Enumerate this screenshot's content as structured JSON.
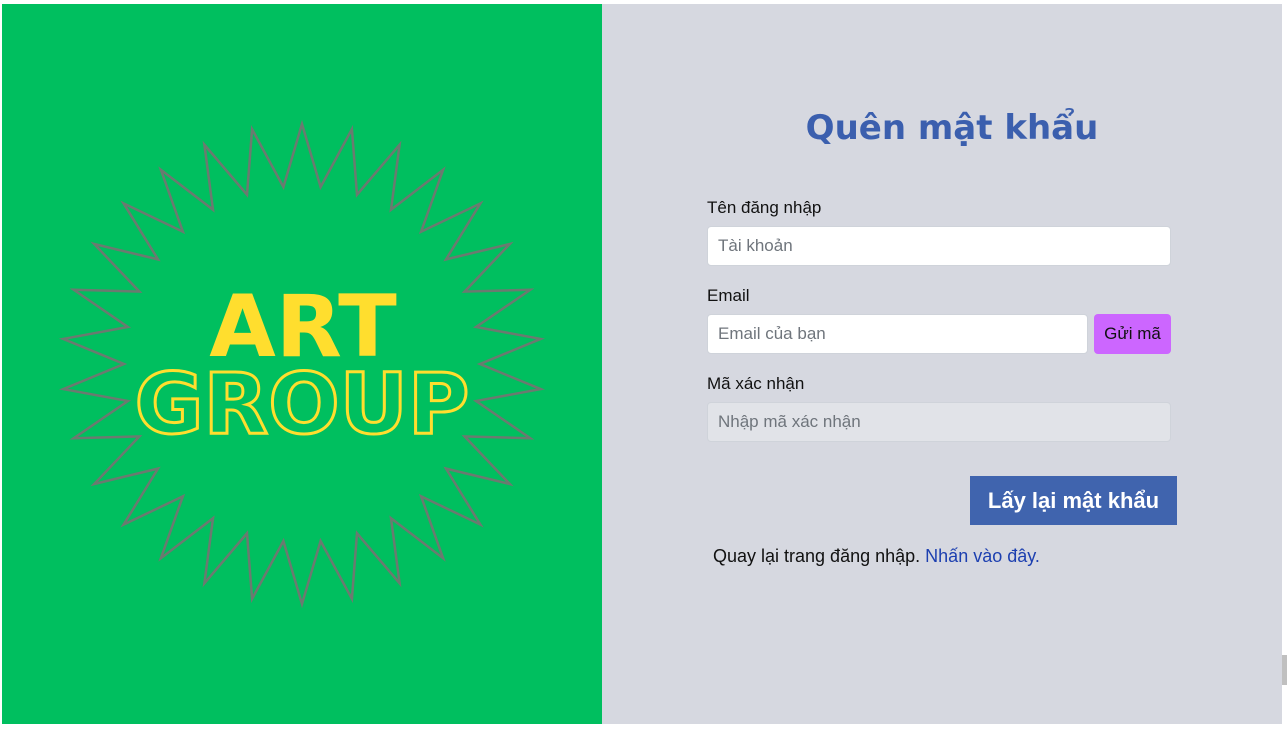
{
  "brand": {
    "line1": "ART",
    "line2": "GROUP",
    "colors": {
      "background": "#00bf5f",
      "text": "#ffde2e",
      "starburst": "#6b7a70"
    }
  },
  "form": {
    "title": "Quên mật khẩu",
    "username": {
      "label": "Tên đăng nhập",
      "placeholder": "Tài khoản",
      "value": ""
    },
    "email": {
      "label": "Email",
      "placeholder": "Email của bạn",
      "value": "",
      "send_code_label": "Gửi mã"
    },
    "code": {
      "label": "Mã xác nhận",
      "placeholder": "Nhập mã xác nhận",
      "value": ""
    },
    "submit_label": "Lấy lại mật khẩu",
    "back_text": "Quay lại trang đăng nhập.",
    "back_link": "Nhấn vào đây."
  },
  "colors": {
    "panel_bg": "#d6d8e0",
    "title": "#3b5fae",
    "submit_bg": "#4064ae",
    "send_code_bg": "#cc66ff",
    "link": "#1c3fb0"
  }
}
